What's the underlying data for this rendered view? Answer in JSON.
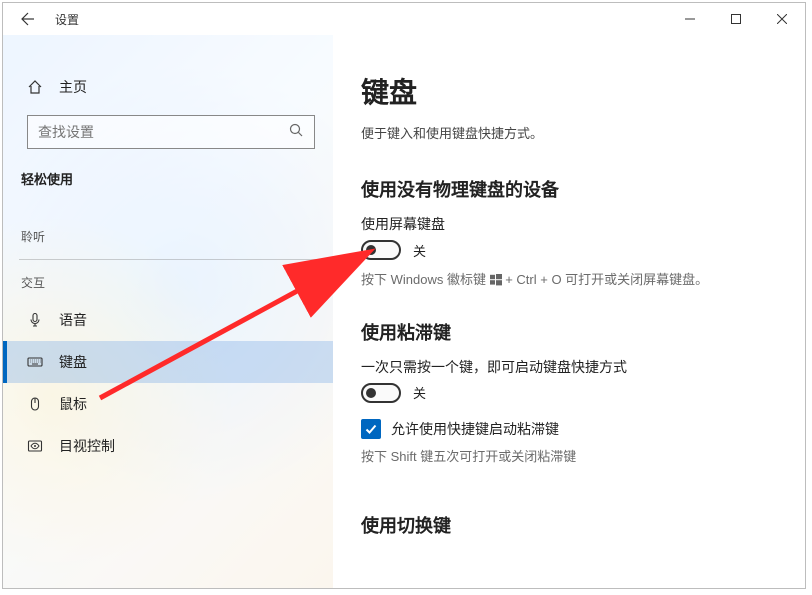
{
  "window": {
    "title": "设置"
  },
  "sidebar": {
    "home": "主页",
    "search_placeholder": "查找设置",
    "category": "轻松使用",
    "groups": {
      "hearing": "聆听",
      "interaction": "交互"
    },
    "items": {
      "speech": "语音",
      "keyboard": "键盘",
      "mouse": "鼠标",
      "eye": "目视控制"
    }
  },
  "page": {
    "title": "键盘",
    "subtitle": "便于键入和使用键盘快捷方式。",
    "section1": {
      "heading": "使用没有物理键盘的设备",
      "option_label": "使用屏幕键盘",
      "toggle_state": "关",
      "hint_prefix": "按下 Windows 徽标键 ",
      "hint_suffix": " + Ctrl + O 可打开或关闭屏幕键盘。"
    },
    "section2": {
      "heading": "使用粘滞键",
      "option_label": "一次只需按一个键，即可启动键盘快捷方式",
      "toggle_state": "关",
      "checkbox_label": "允许使用快捷键启动粘滞键",
      "hint": "按下 Shift 键五次可打开或关闭粘滞键"
    },
    "section3": {
      "heading": "使用切换键"
    }
  }
}
